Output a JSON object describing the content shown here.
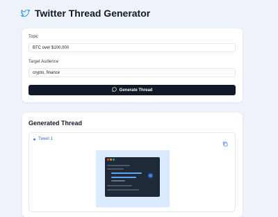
{
  "header": {
    "title": "Twitter Thread Generator",
    "icon": "twitter-bird-icon"
  },
  "form": {
    "topic_label": "Topic",
    "topic_value": "BTC over $100,000",
    "audience_label": "Target Audience",
    "audience_value": "crypto, finance",
    "generate_label": "Generate Thread"
  },
  "thread": {
    "title": "Generated Thread",
    "tweets": [
      {
        "label": "Tweet 1"
      }
    ]
  },
  "colors": {
    "brand": "#1d9bf0",
    "button": "#111827",
    "link": "#2f6fd1",
    "page_bg": "#eef3fa"
  }
}
